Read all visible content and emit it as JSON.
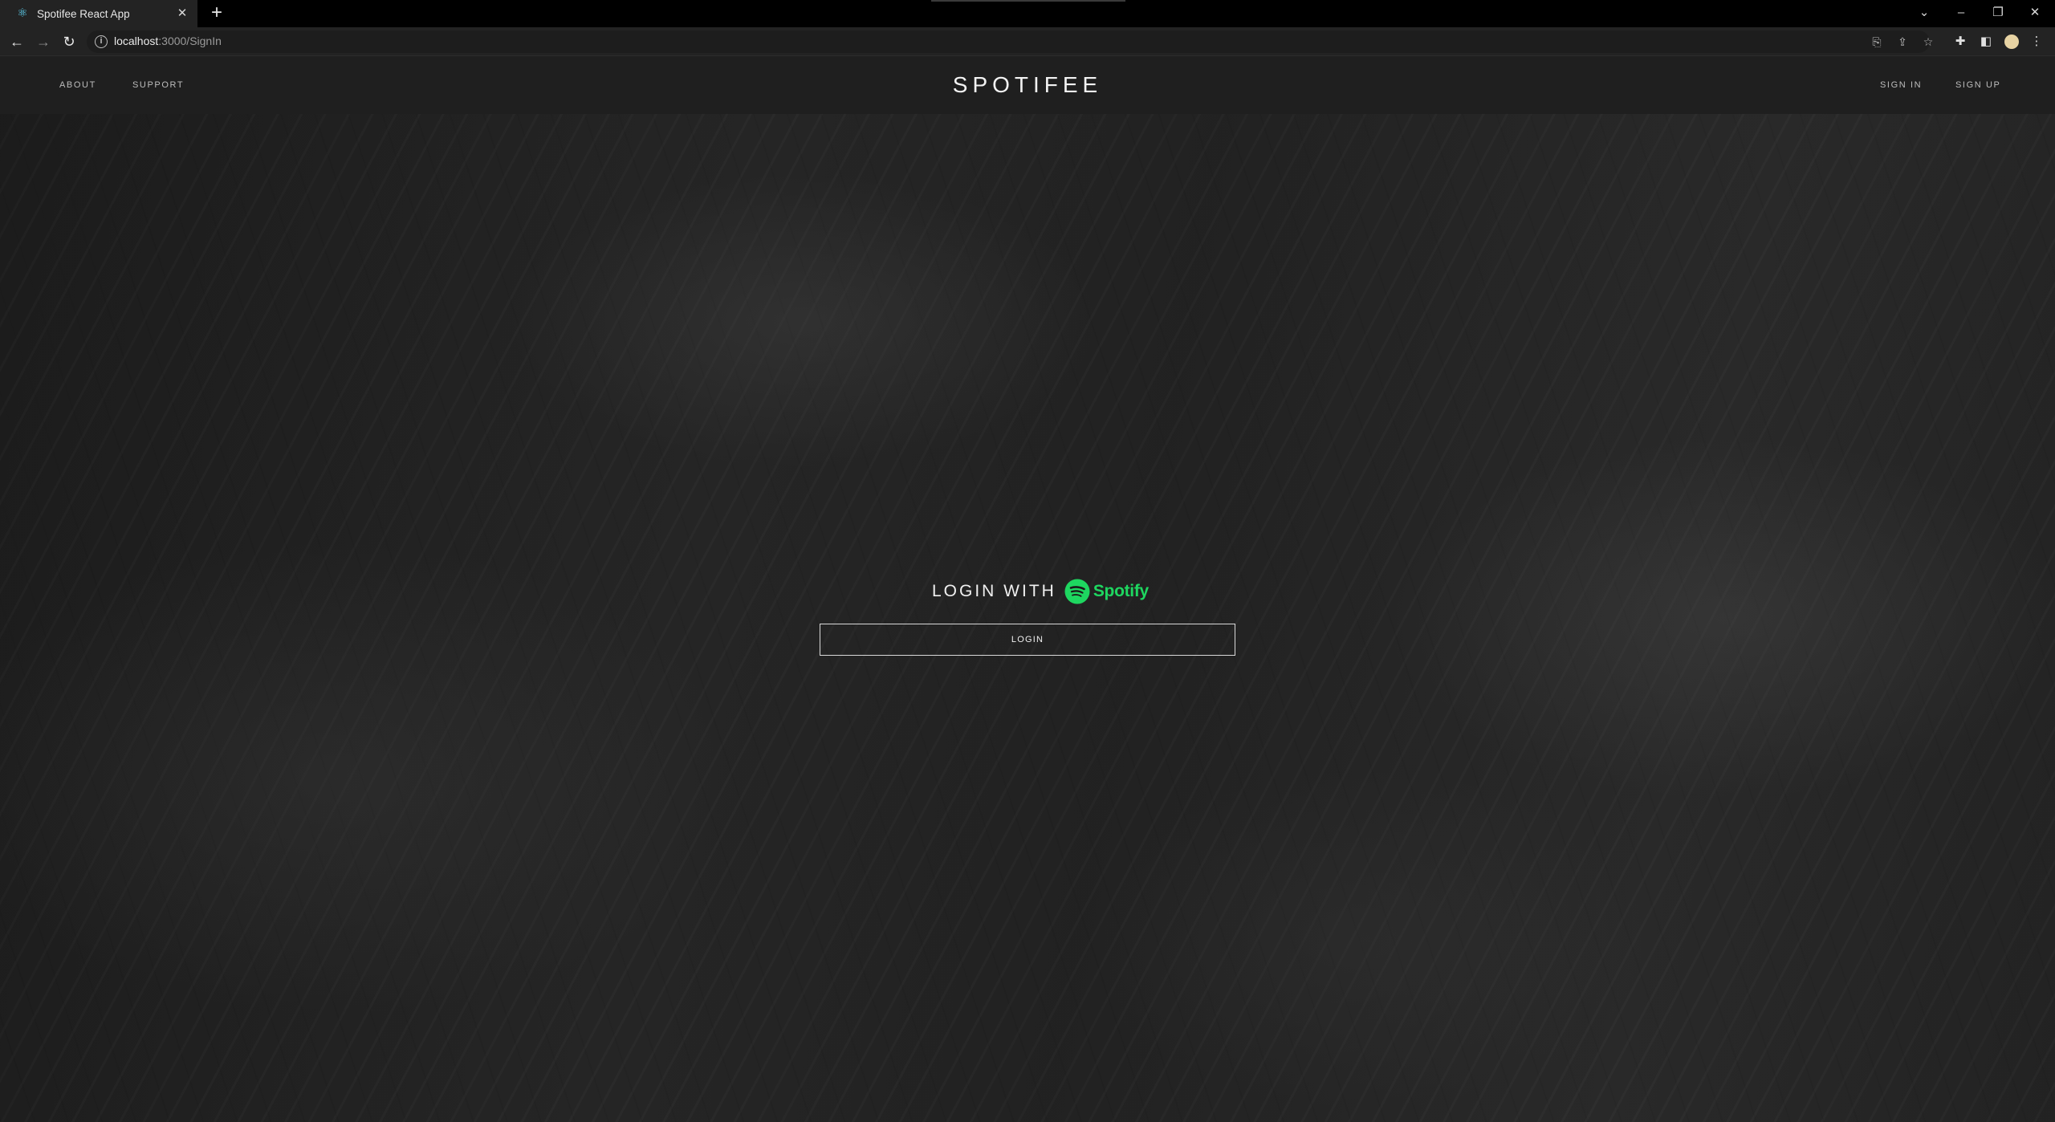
{
  "browser": {
    "tab": {
      "title": "Spotifee React App",
      "favicon": "react-icon"
    },
    "url_host": "localhost",
    "url_path": ":3000/SignIn"
  },
  "nav": {
    "left_links": [
      "ABOUT",
      "SUPPORT"
    ],
    "brand": "SPOTIFEE",
    "right_links": [
      "SIGN IN",
      "SIGN UP"
    ]
  },
  "login": {
    "heading": "LOGIN WITH",
    "provider": "Spotify",
    "button_label": "LOGIN"
  },
  "colors": {
    "spotify_green": "#1ed760",
    "background": "#1a1a1a"
  }
}
